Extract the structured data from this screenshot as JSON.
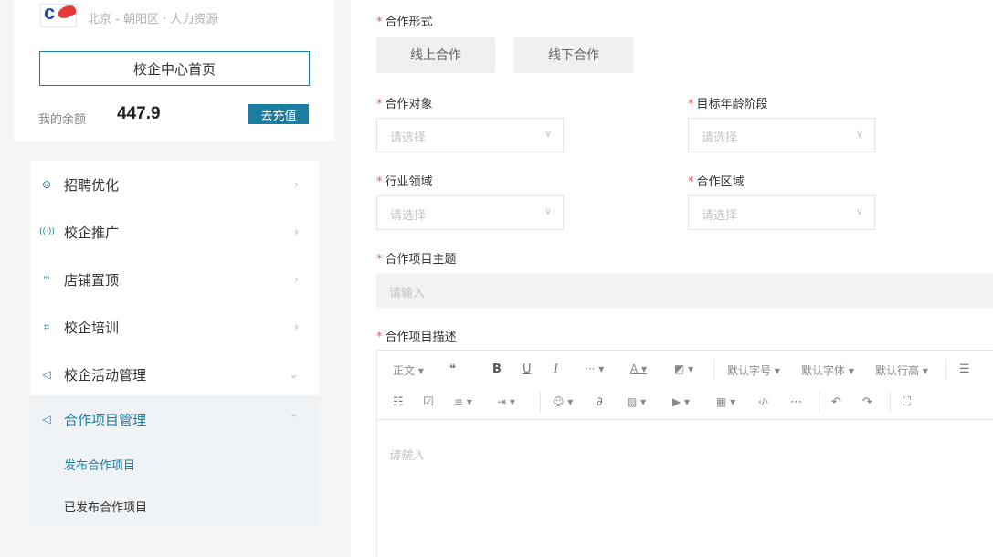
{
  "sidebar": {
    "company_location": "北京 - 朝阳区 · 人力资源",
    "home_button": "校企中心首页",
    "balance_label": "我的余额",
    "balance_value": "447.9",
    "recharge_button": "去充值",
    "menu": [
      {
        "label": "招聘优化",
        "icon": "recruit-icon",
        "glyph": "⊜",
        "arrow": "›"
      },
      {
        "label": "校企推广",
        "icon": "broadcast-icon",
        "glyph": "((·))",
        "arrow": "›"
      },
      {
        "label": "店铺置顶",
        "icon": "chart-icon",
        "glyph": "ᵐ",
        "arrow": "›"
      },
      {
        "label": "校企培训",
        "icon": "training-icon",
        "glyph": "⌗",
        "arrow": "›"
      },
      {
        "label": "校企活动管理",
        "icon": "send-icon",
        "glyph": "◁",
        "arrow": "⌄"
      },
      {
        "label": "合作项目管理",
        "icon": "send-icon",
        "glyph": "◁",
        "arrow": "⌃"
      }
    ],
    "submenu": [
      {
        "label": "发布合作项目"
      },
      {
        "label": "已发布合作项目"
      }
    ]
  },
  "form": {
    "required_mark": "*",
    "cooperation_form": {
      "label": "合作形式",
      "options": [
        "线上合作",
        "线下合作"
      ]
    },
    "cooperation_target": {
      "label": "合作对象",
      "placeholder": "请选择"
    },
    "target_age": {
      "label": "目标年龄阶段",
      "placeholder": "请选择"
    },
    "industry": {
      "label": "行业领域",
      "placeholder": "请选择"
    },
    "region": {
      "label": "合作区域",
      "placeholder": "请选择"
    },
    "topic": {
      "label": "合作项目主题",
      "placeholder": "请输入"
    },
    "description": {
      "label": "合作项目描述",
      "placeholder": "请输入"
    }
  },
  "editor_toolbar": {
    "paragraph": "正文 ▾",
    "quote": "❝",
    "bold": "B",
    "underline": "U",
    "italic": "I",
    "more": "··· ▾",
    "font_color": "A ▾",
    "bg_color": "◩ ▾",
    "font_size": "默认字号 ▾",
    "font_family": "默认字体 ▾",
    "line_height": "默认行高 ▾",
    "bullet_list": "☰",
    "numbered_list": "☷",
    "todo": "☑",
    "align": "≡ ▾",
    "indent": "⇥ ▾",
    "emoji": "☺ ▾",
    "link": "∂",
    "image": "▨ ▾",
    "video": "▶ ▾",
    "table": "▦ ▾",
    "code": "‹/›",
    "divider": "⋯",
    "undo": "↶",
    "redo": "↷",
    "fullscreen": "⛶"
  }
}
